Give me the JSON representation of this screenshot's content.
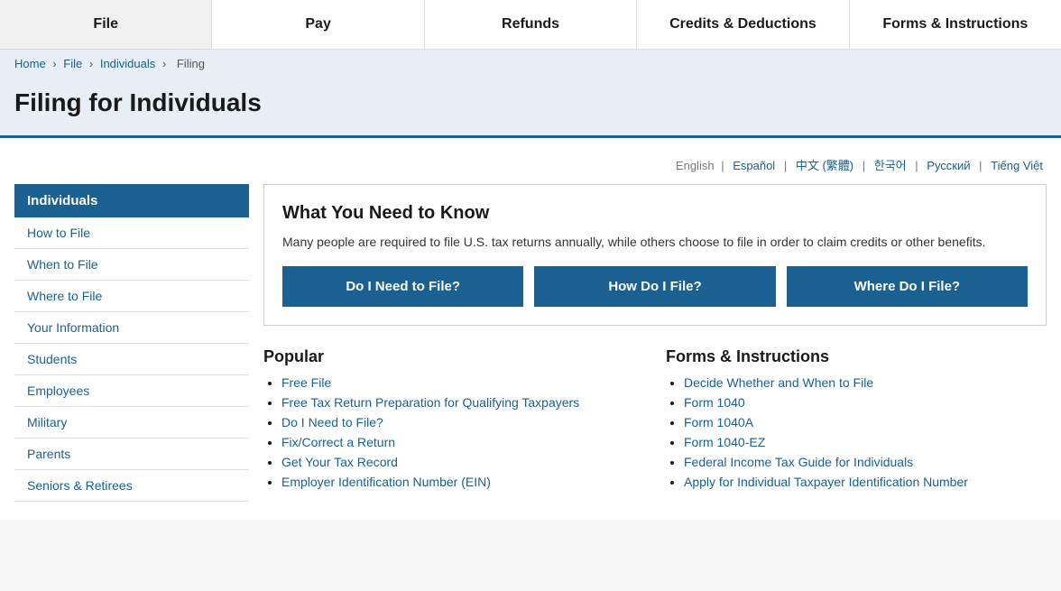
{
  "nav": {
    "items": [
      {
        "label": "File",
        "id": "nav-file"
      },
      {
        "label": "Pay",
        "id": "nav-pay"
      },
      {
        "label": "Refunds",
        "id": "nav-refunds"
      },
      {
        "label": "Credits & Deductions",
        "id": "nav-credits"
      },
      {
        "label": "Forms & Instructions",
        "id": "nav-forms"
      }
    ]
  },
  "breadcrumb": {
    "items": [
      {
        "label": "Home",
        "href": "#"
      },
      {
        "label": "File",
        "href": "#"
      },
      {
        "label": "Individuals",
        "href": "#"
      },
      {
        "label": "Filing",
        "href": "#"
      }
    ]
  },
  "page_title": "Filing for Individuals",
  "languages": {
    "current": "English",
    "others": [
      {
        "label": "Español"
      },
      {
        "label": "中文 (繁體)"
      },
      {
        "label": "한국어"
      },
      {
        "label": "Русский"
      },
      {
        "label": "Tiếng Việt"
      }
    ]
  },
  "sidebar": {
    "section_title": "Individuals",
    "items": [
      {
        "label": "How to File"
      },
      {
        "label": "When to File"
      },
      {
        "label": "Where to File"
      },
      {
        "label": "Your Information"
      },
      {
        "label": "Students"
      },
      {
        "label": "Employees"
      },
      {
        "label": "Military"
      },
      {
        "label": "Parents"
      },
      {
        "label": "Seniors & Retirees"
      }
    ]
  },
  "info_box": {
    "title": "What You Need to Know",
    "description": "Many people are required to file U.S. tax returns annually, while others choose to file in order to claim credits or other benefits.",
    "buttons": [
      {
        "label": "Do I Need to File?"
      },
      {
        "label": "How Do I File?"
      },
      {
        "label": "Where Do I File?"
      }
    ]
  },
  "popular": {
    "heading": "Popular",
    "links": [
      {
        "label": "Free File"
      },
      {
        "label": "Free Tax Return Preparation for Qualifying Taxpayers"
      },
      {
        "label": "Do I Need to File?"
      },
      {
        "label": "Fix/Correct a Return"
      },
      {
        "label": "Get Your Tax Record"
      },
      {
        "label": "Employer Identification Number (EIN)"
      }
    ]
  },
  "forms_instructions": {
    "heading": "Forms & Instructions",
    "links": [
      {
        "label": "Decide Whether and When to File"
      },
      {
        "label": "Form 1040"
      },
      {
        "label": "Form 1040A"
      },
      {
        "label": "Form 1040-EZ"
      },
      {
        "label": "Federal Income Tax Guide for Individuals"
      },
      {
        "label": "Apply for Individual Taxpayer Identification Number"
      }
    ]
  }
}
